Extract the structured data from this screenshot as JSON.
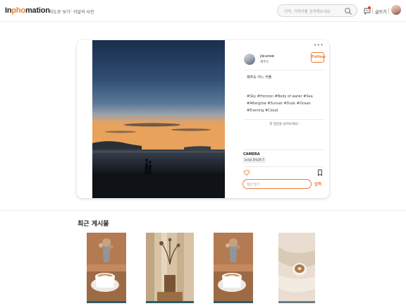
{
  "header": {
    "logo": {
      "text_dark": "In",
      "text_accent": "pho",
      "text_rest": "mation"
    },
    "nav": [
      {
        "label": "지도로 보기"
      },
      {
        "label": "이달의 사진"
      }
    ],
    "search": {
      "placeholder": "지역, 카메라를 검색해보세요"
    },
    "write_label": "글쓰기"
  },
  "post": {
    "author": {
      "name": "jieunee",
      "location": "제주도"
    },
    "follow_label": "Follow",
    "caption": "제주도 어느 커플",
    "tags": "#Sky #Horizon #Body of water #Sea #Afterglow #Sunset #Dusk #Ocean #Evening #Cloud",
    "comment_hint": "첫 댓글을 남겨보세요!",
    "camera": {
      "label": "CAMERA",
      "model": "Leica D-LUX 7"
    },
    "comment": {
      "placeholder": "댓글 달기",
      "submit_label": "입력"
    }
  },
  "recent": {
    "title": "최근 게시물",
    "items": [
      {
        "subject": "latte-with-flowers"
      },
      {
        "subject": "dried-flowers-by-window"
      },
      {
        "subject": "latte-with-flowers"
      },
      {
        "subject": "coffee-on-linen"
      }
    ]
  },
  "colors": {
    "accent": "#f07c2e",
    "notification": "#e53935"
  }
}
